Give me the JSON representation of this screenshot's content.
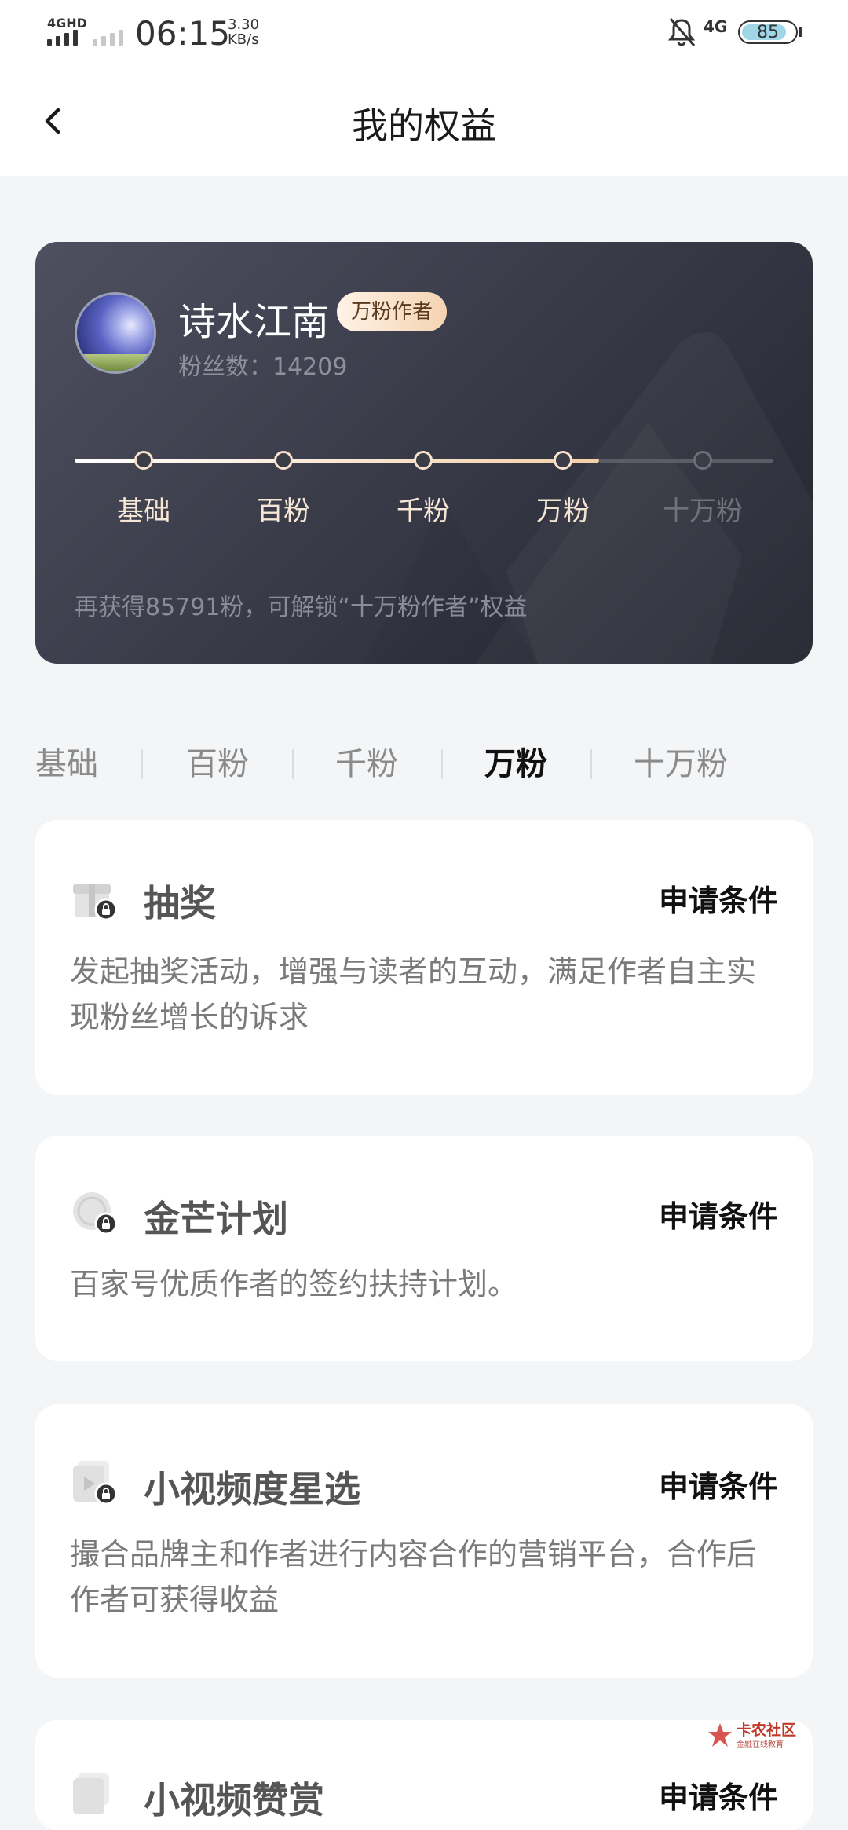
{
  "status_bar": {
    "network": "4GHD",
    "time": "06:15",
    "speed_value": "3.30",
    "speed_unit": "KB/s",
    "network_right": "4G",
    "battery": "85",
    "battery_level": 0.85,
    "icons": [
      "signal-icon",
      "notification-off-icon",
      "battery-icon"
    ]
  },
  "nav": {
    "title": "我的权益",
    "back_icon": "chevron-left-icon"
  },
  "profile": {
    "name": "诗水江南",
    "badge": "万粉作者",
    "fans_label": "粉丝数：",
    "fans_count": "14209",
    "levels": [
      {
        "label": "基础",
        "reached": true
      },
      {
        "label": "百粉",
        "reached": true
      },
      {
        "label": "千粉",
        "reached": true
      },
      {
        "label": "万粉",
        "reached": true
      },
      {
        "label": "十万粉",
        "reached": false
      }
    ],
    "unlock_text": "再获得85791粉，可解锁“十万粉作者”权益"
  },
  "tabs": [
    {
      "label": "基础",
      "active": false
    },
    {
      "label": "百粉",
      "active": false
    },
    {
      "label": "千粉",
      "active": false
    },
    {
      "label": "万粉",
      "active": true
    },
    {
      "label": "十万粉",
      "active": false
    }
  ],
  "benefits": [
    {
      "title": "抽奖",
      "condition": "申请条件",
      "desc": "发起抽奖活动，增强与读者的互动，满足作者自主实现粉丝增长的诉求",
      "icon": "gift-lock-icon"
    },
    {
      "title": "金芒计划",
      "condition": "申请条件",
      "desc": "百家号优质作者的签约扶持计划。",
      "icon": "gold-coin-lock-icon"
    },
    {
      "title": "小视频度星选",
      "condition": "申请条件",
      "desc": "撮合品牌主和作者进行内容合作的营销平台，合作后作者可获得收益",
      "icon": "video-lock-icon"
    },
    {
      "title": "小视频赞赏",
      "condition": "申请条件",
      "desc": "",
      "icon": "video-lock-icon"
    }
  ],
  "watermark": {
    "name": "卡农社区",
    "sub": "金融在线教育"
  },
  "colors": {
    "hero_bg": "#3a3c4a",
    "badge_bg": "#f4d3b2",
    "progress_done": "#f3cfa8",
    "page_bg": "#f4f5f7"
  }
}
